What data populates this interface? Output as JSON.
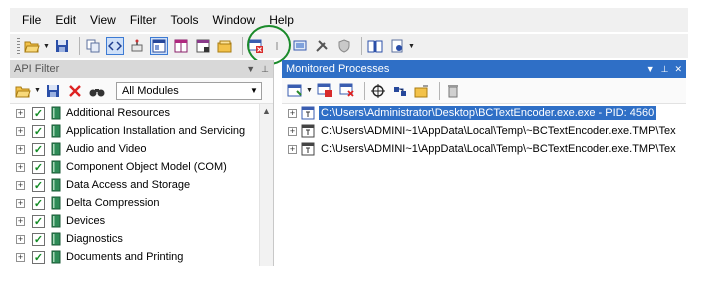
{
  "menubar": {
    "items": [
      "File",
      "Edit",
      "View",
      "Filter",
      "Tools",
      "Window",
      "Help"
    ]
  },
  "toolbar": {
    "buttons": [
      "open-folder-icon",
      "save-icon",
      "copy-icon",
      "code-view-icon",
      "hook-icon",
      "window-layout-icon",
      "split-view-icon",
      "panel-icon",
      "folder-stack-icon",
      "monitor-new-process-icon",
      "divider-icon",
      "monitor-icon",
      "tools-icon",
      "shield-icon",
      "book-icon",
      "help-page-icon"
    ]
  },
  "api_filter": {
    "title": "API Filter",
    "module_select": "All Modules",
    "items": [
      "Additional Resources",
      "Application Installation and Servicing",
      "Audio and Video",
      "Component Object Model (COM)",
      "Data Access and Storage",
      "Delta Compression",
      "Devices",
      "Diagnostics",
      "Documents and Printing"
    ]
  },
  "monitored_processes": {
    "title": "Monitored Processes",
    "processes": [
      "C:\\Users\\Administrator\\Desktop\\BCTextEncoder.exe.exe - PID: 4560",
      "C:\\Users\\ADMINI~1\\AppData\\Local\\Temp\\~BCTextEncoder.exe.TMP\\Tex",
      "C:\\Users\\ADMINI~1\\AppData\\Local\\Temp\\~BCTextEncoder.exe.TMP\\Tex"
    ]
  },
  "colors": {
    "accent": "#2f6fc6",
    "annotation_circle": "#1a8a2a",
    "check": "#138b24"
  }
}
